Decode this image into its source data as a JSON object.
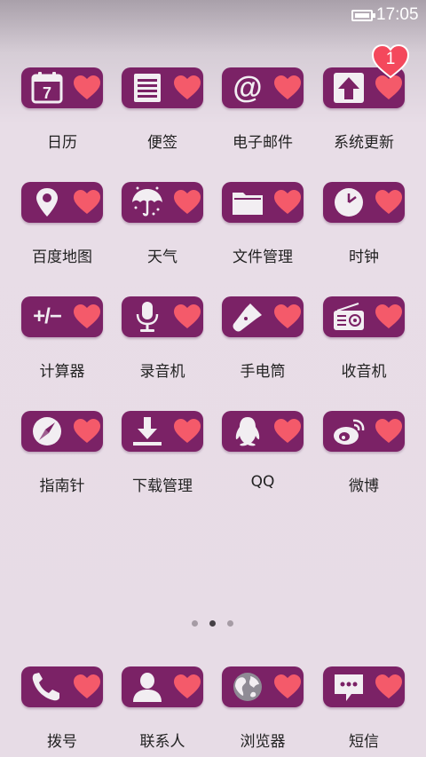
{
  "status_bar": {
    "time": "17:05",
    "battery": "battery-icon"
  },
  "colors": {
    "tile": "#7b2266",
    "heart": "#f45a6a",
    "icon": "#f2eef2",
    "badge": "#f4485c"
  },
  "apps": [
    {
      "label": "日历",
      "icon": "calendar-icon",
      "calendar_day": "7"
    },
    {
      "label": "便签",
      "icon": "notes-icon"
    },
    {
      "label": "电子邮件",
      "icon": "email-icon",
      "glyph": "@"
    },
    {
      "label": "系统更新",
      "icon": "update-arrow-icon",
      "badge": "1"
    },
    {
      "label": "百度地图",
      "icon": "map-pin-icon"
    },
    {
      "label": "天气",
      "icon": "umbrella-icon"
    },
    {
      "label": "文件管理",
      "icon": "folder-icon"
    },
    {
      "label": "时钟",
      "icon": "clock-icon"
    },
    {
      "label": "计算器",
      "icon": "calculator-icon",
      "glyph": "+/−"
    },
    {
      "label": "录音机",
      "icon": "microphone-icon"
    },
    {
      "label": "手电筒",
      "icon": "flashlight-icon"
    },
    {
      "label": "收音机",
      "icon": "radio-icon"
    },
    {
      "label": "指南针",
      "icon": "compass-icon"
    },
    {
      "label": "下载管理",
      "icon": "download-icon"
    },
    {
      "label": "QQ",
      "icon": "qq-penguin-icon"
    },
    {
      "label": "微博",
      "icon": "weibo-icon"
    }
  ],
  "pager": {
    "pages": 3,
    "active": 2
  },
  "dock": [
    {
      "label": "拨号",
      "icon": "phone-icon"
    },
    {
      "label": "联系人",
      "icon": "contact-icon"
    },
    {
      "label": "浏览器",
      "icon": "globe-icon"
    },
    {
      "label": "短信",
      "icon": "message-icon"
    }
  ]
}
